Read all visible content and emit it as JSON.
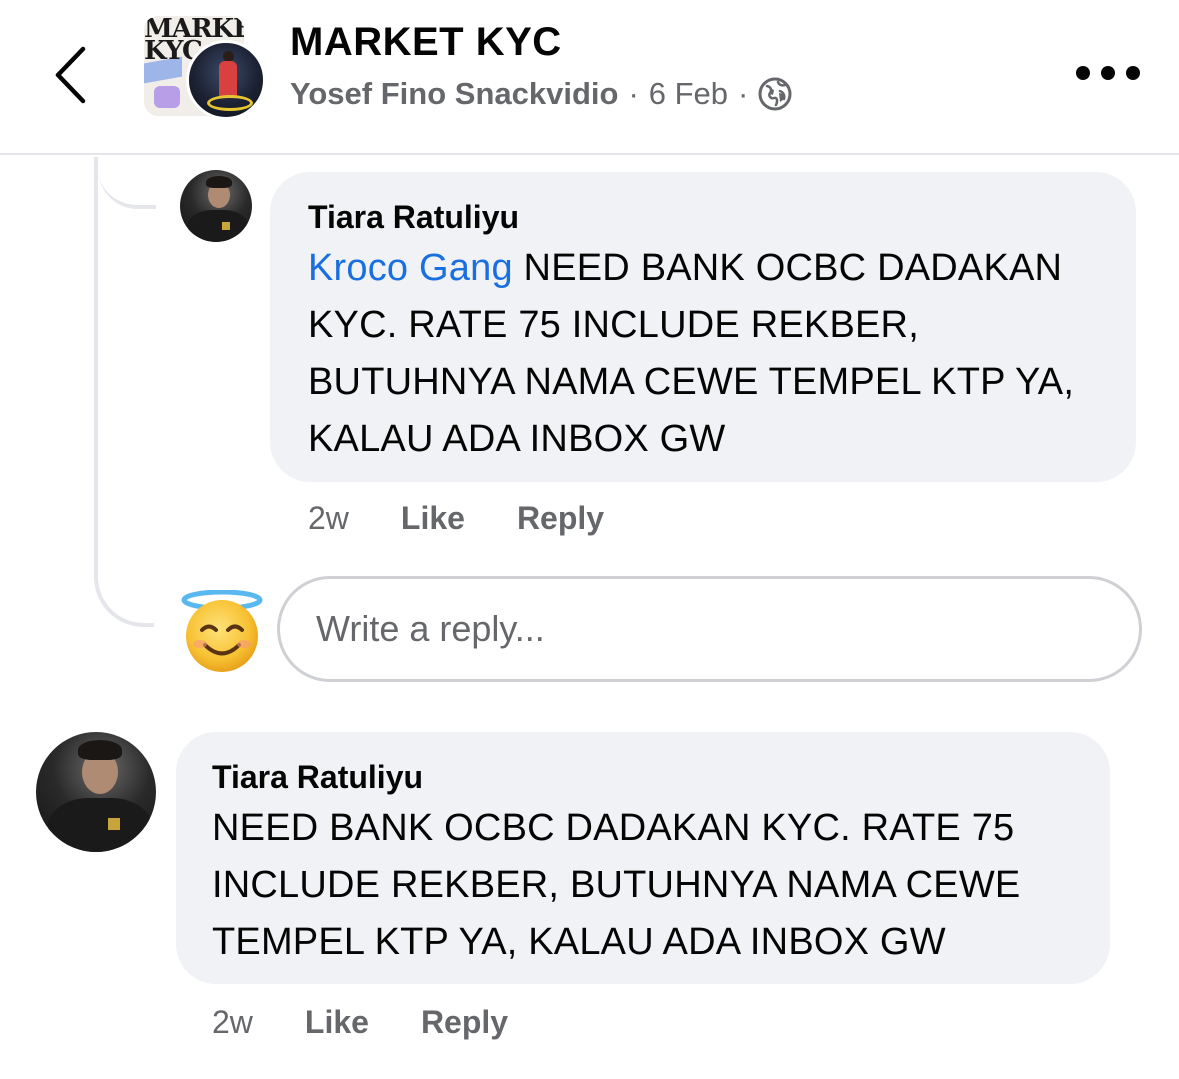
{
  "header": {
    "back_icon": "chevron-left-icon",
    "group_logo_text": "MARKET\nKYC",
    "title": "MARKET KYC",
    "author": "Yosef Fino Snackvidio",
    "separator": "·",
    "date": "6 Feb",
    "privacy_icon": "globe-icon",
    "more_icon": "more-horizontal-icon"
  },
  "comments": [
    {
      "name": "Tiara Ratuliyu",
      "mention": "Kroco Gang",
      "text": " NEED BANK OCBC DADAKAN KYC. RATE 75 INCLUDE REKBER, BUTUHNYA NAMA CEWE TEMPEL KTP YA, KALAU ADA INBOX GW",
      "time": "2w",
      "like_label": "Like",
      "reply_label": "Reply"
    },
    {
      "name": "Tiara Ratuliyu",
      "text": "NEED BANK OCBC DADAKAN KYC. RATE 75 INCLUDE REKBER, BUTUHNYA NAMA CEWE TEMPEL KTP YA, KALAU ADA INBOX GW",
      "time": "2w",
      "like_label": "Like",
      "reply_label": "Reply"
    }
  ],
  "reply_box": {
    "emoji": "smiling-face-with-halo-icon",
    "placeholder": "Write a reply..."
  },
  "colors": {
    "bubble": "#f0f2f5",
    "mention": "#1a6fe0",
    "secondary_text": "#65676b",
    "primary_text": "#050505"
  }
}
